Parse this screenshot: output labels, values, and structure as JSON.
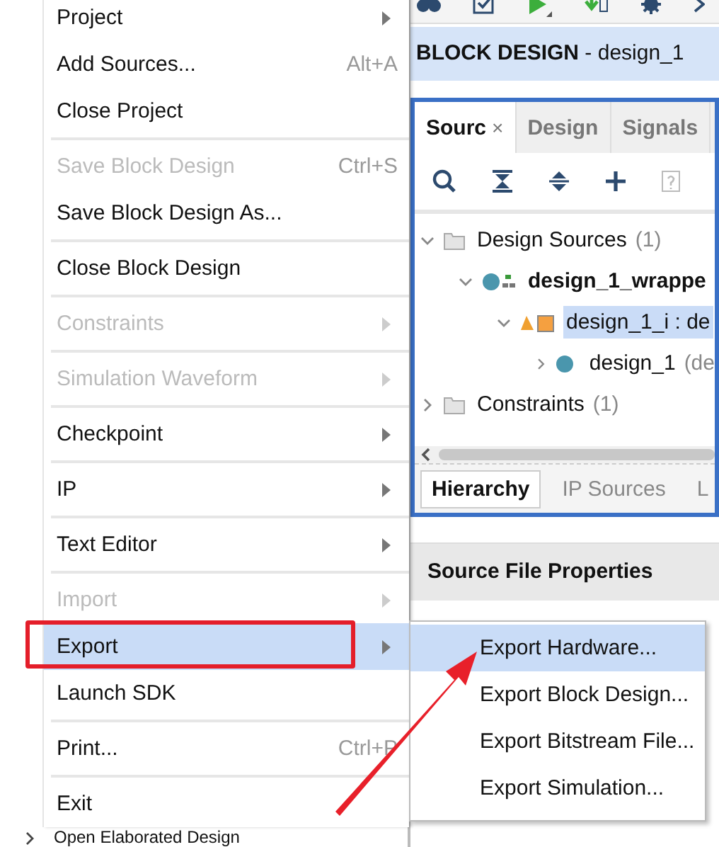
{
  "background": {
    "bottom_row": {
      "label": "Open Elaborated Design",
      "expanded": false
    },
    "header": "**BLOCK DESIGN** - design_1",
    "sources_panel": {
      "tabs": [
        {
          "label": "Sourc",
          "close": "×",
          "selected": true
        },
        {
          "label": "Design",
          "selected": false
        },
        {
          "label": "Signals",
          "selected": false
        }
      ],
      "tree": [
        {
          "kind": "folder",
          "label": "Design Sources",
          "count": "(1)",
          "expanded": true,
          "selected": false,
          "children": [
            {
              "kind": "wrapper",
              "label": "design_1_wrappe",
              "expanded": true,
              "selected": false,
              "children": [
                {
                  "kind": "instance",
                  "label": "design_1_i : de",
                  "expanded": true,
                  "selected": true,
                  "children": [
                    {
                      "kind": "design",
                      "label": "design_1",
                      "count": "(de",
                      "expanded": false,
                      "selected": false
                    }
                  ]
                }
              ]
            }
          ]
        },
        {
          "kind": "folder",
          "label": "Constraints",
          "count": "(1)",
          "expanded": false,
          "selected": false
        }
      ],
      "bottom_tabs": [
        {
          "label": "Hierarchy",
          "selected": true
        },
        {
          "label": "IP Sources",
          "selected": false
        },
        {
          "label": "L",
          "selected": false
        }
      ]
    },
    "properties_title": "Source File Properties"
  },
  "menu": {
    "items": [
      {
        "kind": "item",
        "label": "Project",
        "submenu": true,
        "disabled": false,
        "selected": false
      },
      {
        "kind": "item",
        "label": "Add Sources...",
        "shortcut": "Alt+A",
        "submenu": false,
        "disabled": false,
        "selected": false
      },
      {
        "kind": "item",
        "label": "Close Project",
        "submenu": false,
        "disabled": false,
        "selected": false
      },
      {
        "kind": "separator"
      },
      {
        "kind": "item",
        "label": "Save Block Design",
        "shortcut": "Ctrl+S",
        "submenu": false,
        "disabled": true,
        "selected": false
      },
      {
        "kind": "item",
        "label": "Save Block Design As...",
        "submenu": false,
        "disabled": false,
        "selected": false
      },
      {
        "kind": "separator"
      },
      {
        "kind": "item",
        "label": "Close Block Design",
        "submenu": false,
        "disabled": false,
        "selected": false
      },
      {
        "kind": "separator"
      },
      {
        "kind": "item",
        "label": "Constraints",
        "submenu": true,
        "disabled": true,
        "selected": false
      },
      {
        "kind": "separator"
      },
      {
        "kind": "item",
        "label": "Simulation Waveform",
        "submenu": true,
        "disabled": true,
        "selected": false
      },
      {
        "kind": "separator"
      },
      {
        "kind": "item",
        "label": "Checkpoint",
        "submenu": true,
        "disabled": false,
        "selected": false
      },
      {
        "kind": "separator"
      },
      {
        "kind": "item",
        "label": "IP",
        "submenu": true,
        "disabled": false,
        "selected": false
      },
      {
        "kind": "separator"
      },
      {
        "kind": "item",
        "label": "Text Editor",
        "submenu": true,
        "disabled": false,
        "selected": false
      },
      {
        "kind": "separator"
      },
      {
        "kind": "item",
        "label": "Import",
        "submenu": true,
        "disabled": true,
        "selected": false
      },
      {
        "kind": "item",
        "label": "Export",
        "submenu": true,
        "disabled": false,
        "selected": true
      },
      {
        "kind": "item",
        "label": "Launch SDK",
        "submenu": false,
        "disabled": false,
        "selected": false
      },
      {
        "kind": "separator"
      },
      {
        "kind": "item",
        "label": "Print...",
        "shortcut": "Ctrl+P",
        "submenu": false,
        "disabled": false,
        "selected": false
      },
      {
        "kind": "separator"
      },
      {
        "kind": "item",
        "label": "Exit",
        "submenu": false,
        "disabled": false,
        "selected": false
      }
    ]
  },
  "submenu": {
    "items": [
      {
        "label": "Export Hardware...",
        "selected": true
      },
      {
        "label": "Export Block Design...",
        "selected": false
      },
      {
        "label": "Export Bitstream File...",
        "selected": false
      },
      {
        "label": "Export Simulation...",
        "selected": false
      }
    ]
  }
}
